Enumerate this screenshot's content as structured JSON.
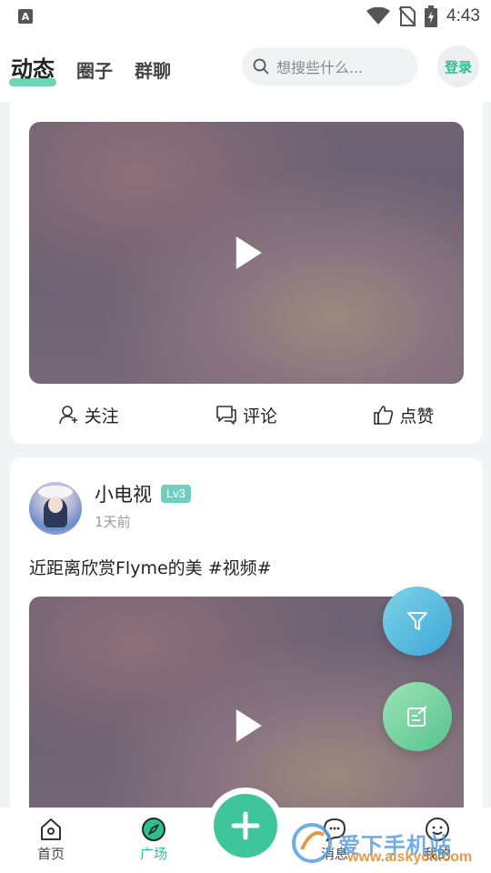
{
  "status_bar": {
    "time": "4:43",
    "left_icon": "A"
  },
  "header": {
    "tabs": [
      {
        "label": "动态",
        "active": true
      },
      {
        "label": "圈子",
        "active": false
      },
      {
        "label": "群聊",
        "active": false
      }
    ],
    "search_placeholder": "想搜些什么...",
    "login_label": "登录"
  },
  "card1": {
    "cut_text": "……",
    "actions": {
      "follow": "关注",
      "comment": "评论",
      "like": "点赞"
    }
  },
  "card2": {
    "username": "小电视",
    "level": "Lv3",
    "time": "1天前",
    "text": "近距离欣赏Flyme的美 #视频#"
  },
  "bottom_nav": {
    "home": "首页",
    "square": "广场",
    "messages": "消息",
    "mine": "我的"
  },
  "watermark": {
    "name": "爱下手机站",
    "url": "www.aiskych.com"
  },
  "colors": {
    "accent": "#3ec59a",
    "level_badge": "#6fcfc2"
  }
}
